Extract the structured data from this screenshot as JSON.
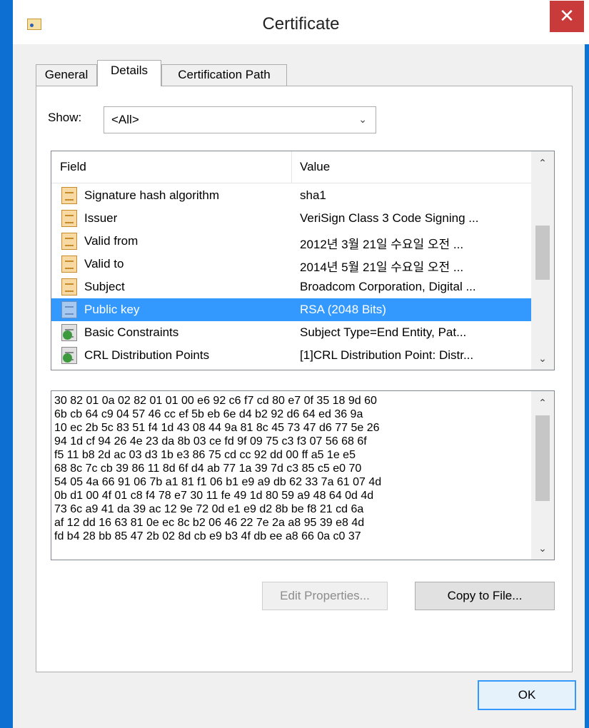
{
  "window": {
    "title": "Certificate",
    "close_label": "✕"
  },
  "tabs": [
    {
      "label": "General"
    },
    {
      "label": "Details"
    },
    {
      "label": "Certification Path"
    }
  ],
  "show": {
    "label": "Show:",
    "selected": "<All>"
  },
  "list": {
    "columns": {
      "field": "Field",
      "value": "Value"
    },
    "rows": [
      {
        "field": "Signature hash algorithm",
        "value": "sha1"
      },
      {
        "field": "Issuer",
        "value": "VeriSign Class 3 Code Signing ..."
      },
      {
        "field": "Valid from",
        "value": "2012년 3월 21일 수요일 오전 ..."
      },
      {
        "field": "Valid to",
        "value": "2014년 5월 21일 수요일 오전 ..."
      },
      {
        "field": "Subject",
        "value": "Broadcom Corporation, Digital ..."
      },
      {
        "field": "Public key",
        "value": "RSA (2048 Bits)"
      },
      {
        "field": "Basic Constraints",
        "value": "Subject Type=End Entity, Pat..."
      },
      {
        "field": "CRL Distribution Points",
        "value": "[1]CRL Distribution Point: Distr..."
      }
    ]
  },
  "hex": {
    "lines": [
      "30 82 01 0a 02 82 01 01 00 e6 92 c6 f7 cd 80 e7 0f 35 18 9d 60",
      "6b cb 64 c9 04 57 46 cc ef 5b eb 6e d4 b2 92 d6 64 ed 36 9a",
      "10 ec 2b 5c 83 51 f4 1d 43 08 44 9a 81 8c 45 73 47 d6 77 5e 26",
      "94 1d cf 94 26 4e 23 da 8b 03 ce fd 9f 09 75 c3 f3 07 56 68 6f",
      "f5 11 b8 2d ac 03 d3 1b e3 86 75 cd cc 92 dd 00 ff a5 1e e5",
      "68 8c 7c cb 39 86 11 8d 6f d4 ab 77 1a 39 7d c3 85 c5 e0 70",
      "54 05 4a 66 91 06 7b a1 81 f1 06 b1 e9 a9 db 62 33 7a 61 07 4d",
      "0b d1 00 4f 01 c8 f4 78 e7 30 11 fe 49 1d 80 59 a9 48 64 0d 4d",
      "73 6c a9 41 da 39 ac 12 9e 72 0d e1 e9 d2 8b be f8 21 cd 6a",
      "af 12 dd 16 63 81 0e ec 8c b2 06 46 22 7e 2a a8 95 39 e8 4d",
      "fd b4 28 bb 85 47 2b 02 8d cb e9 b3 4f db ee a8 66 0a c0 37"
    ]
  },
  "buttons": {
    "edit_properties": "Edit Properties...",
    "copy_to_file": "Copy to File...",
    "ok": "OK"
  }
}
